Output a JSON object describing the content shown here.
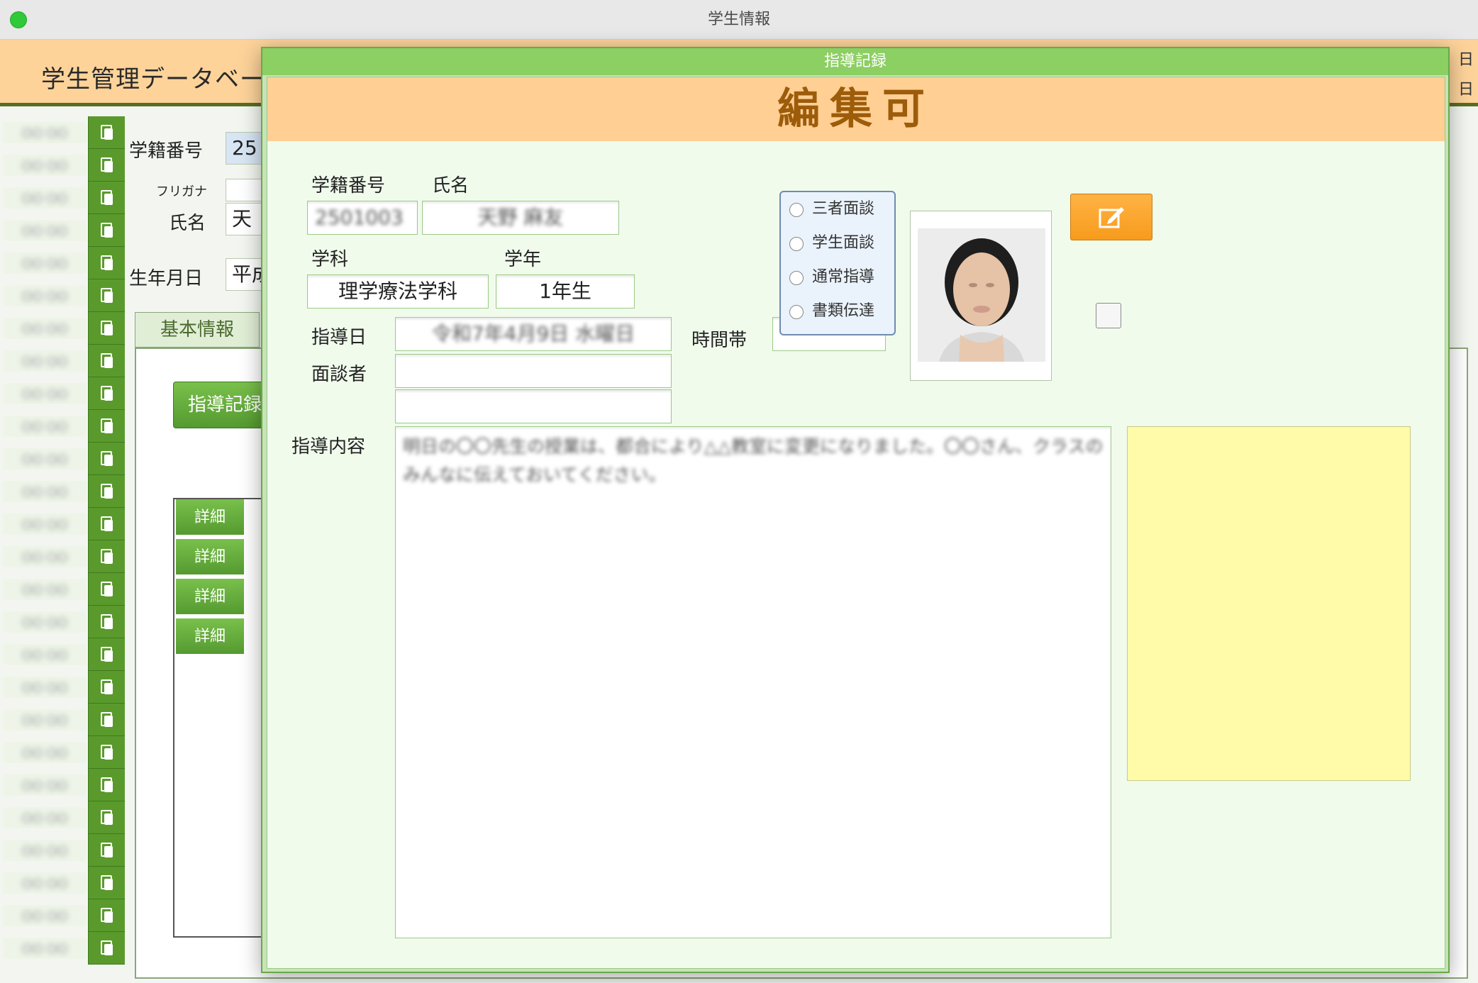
{
  "window": {
    "title": "学生情報"
  },
  "header": {
    "app_title": "学生管理データベース",
    "right_top": "日",
    "right_bottom": "日"
  },
  "sidebar": {
    "names": [
      "○○ ○○",
      "○○ ○○",
      "○○ ○○",
      "○○ ○○",
      "○○ ○○",
      "○○ ○○",
      "○○ ○○",
      "○○ ○○",
      "○○ ○○",
      "○○ ○○",
      "○○ ○○",
      "○○ ○○",
      "○○ ○○",
      "○○ ○○",
      "○○ ○○",
      "○○ ○○",
      "○○ ○○",
      "○○ ○○",
      "○○ ○○",
      "○○ ○○",
      "○○ ○○",
      "○○ ○○",
      "○○ ○○",
      "○○ ○○",
      "○○ ○○",
      "○○ ○○"
    ]
  },
  "background_form": {
    "student_no_label": "学籍番号",
    "student_no_value": "25",
    "furigana_label": "フリガナ",
    "name_label": "氏名",
    "name_value": "天",
    "birthdate_label": "生年月日",
    "birthdate_value": "平成",
    "tab_basic": "基本情報",
    "guidance_button": "指導記録",
    "detail_buttons": [
      "詳細",
      "詳細",
      "詳細",
      "詳細"
    ]
  },
  "modal": {
    "title": "指導記録",
    "banner": "編集可",
    "student_no_label": "学籍番号",
    "student_no_value": "2501003",
    "name_label": "氏名",
    "name_value": "天野 麻友",
    "department_label": "学科",
    "department_value": "理学療法学科",
    "grade_label": "学年",
    "grade_value": "1年生",
    "guidance_date_label": "指導日",
    "guidance_date_value": "令和7年4月9日 水曜日",
    "time_slot_label": "時間帯",
    "time_slot_value": "",
    "interviewer_label": "面談者",
    "interviewer_value_1": "",
    "interviewer_value_2": "",
    "content_label": "指導内容",
    "content_value": "明日の〇〇先生の授業は、都合により△△教室に変更になりました。〇〇さん、クラスのみんなに伝えておいてください。",
    "radio_options": [
      "三者面談",
      "学生面談",
      "通常指導",
      "書類伝達"
    ]
  },
  "colors": {
    "accent_green": "#5a9a2c",
    "header_orange": "#fdd39a",
    "banner_orange": "#ffcf94",
    "edit_orange": "#f79b1c",
    "note_yellow": "#fffba8"
  },
  "icons": {
    "copy": "copy-icon",
    "edit": "edit-icon"
  }
}
